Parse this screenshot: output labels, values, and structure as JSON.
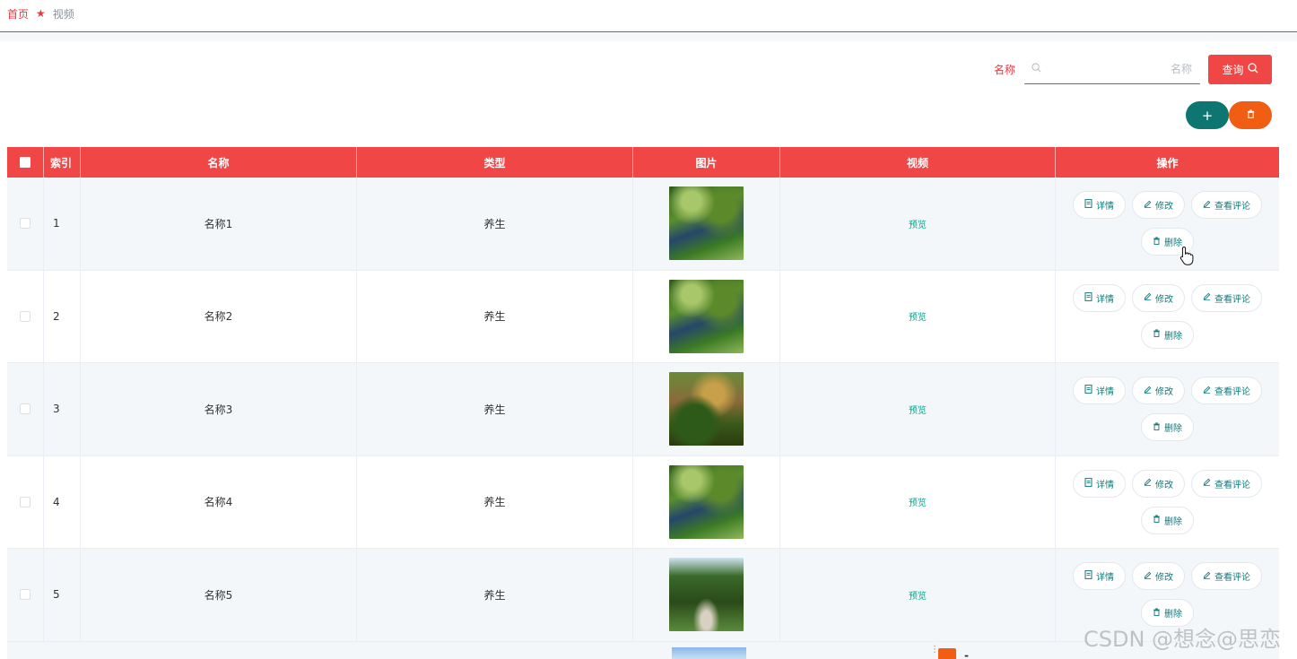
{
  "breadcrumb": {
    "home": "首页",
    "current": "视频"
  },
  "search": {
    "label": "名称",
    "placeholder": "名称",
    "value": "",
    "button": "查询"
  },
  "toolbar": {
    "add": "+",
    "delete": "🗑"
  },
  "table": {
    "columns": [
      "索引",
      "名称",
      "类型",
      "图片",
      "视频",
      "操作"
    ],
    "rows": [
      {
        "index": "1",
        "name": "名称1",
        "type": "养生",
        "video": "预览",
        "image_theme": "willow-pond"
      },
      {
        "index": "2",
        "name": "名称2",
        "type": "养生",
        "video": "预览",
        "image_theme": "willow-pond"
      },
      {
        "index": "3",
        "name": "名称3",
        "type": "养生",
        "video": "预览",
        "image_theme": "garden-maze"
      },
      {
        "index": "4",
        "name": "名称4",
        "type": "养生",
        "video": "预览",
        "image_theme": "willow-pond"
      },
      {
        "index": "5",
        "name": "名称5",
        "type": "养生",
        "video": "预览",
        "image_theme": "forest-path"
      }
    ],
    "actions": {
      "detail": "详情",
      "edit": "修改",
      "comments": "查看评论",
      "delete": "删除"
    }
  },
  "watermark": "CSDN @想念@思恋",
  "colors": {
    "primary": "#f14646",
    "teal": "#0d7670",
    "orange": "#f25d14",
    "link": "#0aa38a"
  }
}
